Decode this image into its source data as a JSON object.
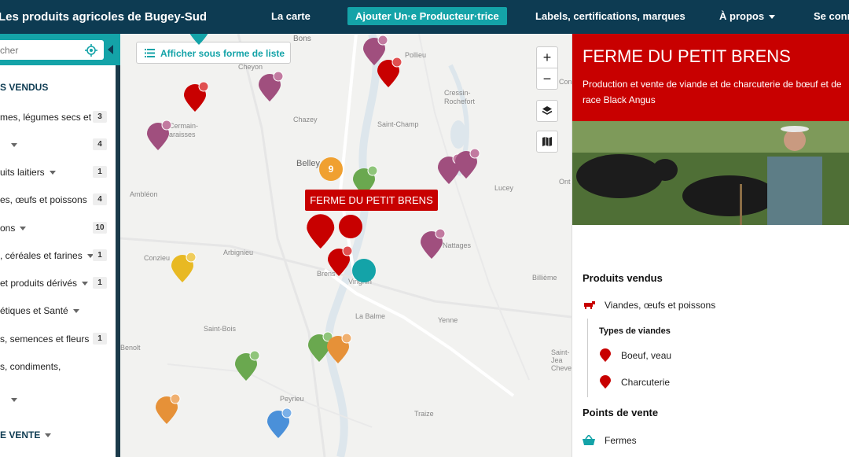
{
  "header": {
    "title": "Les produits agricoles de Bugey-Sud",
    "nav": {
      "map": "La carte",
      "add_producer": "Ajouter Un·e Producteur·trice",
      "labels": "Labels, certifications, marques",
      "about": "À propos",
      "login": "Se conn"
    }
  },
  "sidebar": {
    "search_placeholder": "cher",
    "section_products": "S VENDUS",
    "categories": [
      {
        "label": "mes, légumes secs et",
        "count": "3"
      },
      {
        "label": "",
        "count": "4"
      },
      {
        "label": "uits laitiers",
        "count": "1"
      },
      {
        "label": "es, œufs et poissons",
        "count": "4"
      },
      {
        "label": "ons",
        "count": "10"
      },
      {
        "label": ", céréales et farines",
        "count": "1"
      },
      {
        "label": "et produits dérivés",
        "count": "1"
      },
      {
        "label": "étiques et Santé",
        "count": ""
      },
      {
        "label": "s, semences et fleurs",
        "count": "1"
      },
      {
        "label": "s, condiments,",
        "count": ""
      }
    ],
    "section_sale": "E VENTE"
  },
  "map": {
    "list_button": "Afficher sous forme de liste",
    "zoom_in": "+",
    "zoom_out": "−",
    "tooltip": "FERME DU PETIT BRENS",
    "cluster_count": "9",
    "labels": [
      "Bons",
      "Pollieu",
      "Cressin-Rochefort",
      "Chazey",
      "Saint-Champ",
      "Cermain-araisses",
      "Belley",
      "Ambléon",
      "Lucey",
      "Ont",
      "Arbignieu",
      "Conzieu",
      "Nattages",
      "Brens",
      "Virignin",
      "Billième",
      "La Balme",
      "Yenne",
      "Saint-Bois",
      "Benolt",
      "Saint-Jea Cheve",
      "Peyrieu",
      "Traize",
      "Con",
      "Cheyon"
    ]
  },
  "panel": {
    "name": "FERME DU PETIT BRENS",
    "description": "Production et vente de viande et de charcuterie de bœuf et de race Black Angus",
    "products_title": "Produits vendus",
    "product_category": "Viandes, œufs et poissons",
    "meat_types_title": "Types de viandes",
    "meat_types": [
      "Boeuf, veau",
      "Charcuterie"
    ],
    "sales_title": "Points de vente",
    "sales_point": "Fermes"
  },
  "colors": {
    "header_bg": "#0d3b52",
    "accent_teal": "#14a3a8",
    "farm_red": "#c80000",
    "wine_purple": "#a04f7e",
    "veg_green": "#6aa84f",
    "fruit_orange": "#e69138",
    "cluster_orange": "#f0a030",
    "honey_yellow": "#e8b923",
    "blue_marker": "#4a90d9"
  }
}
